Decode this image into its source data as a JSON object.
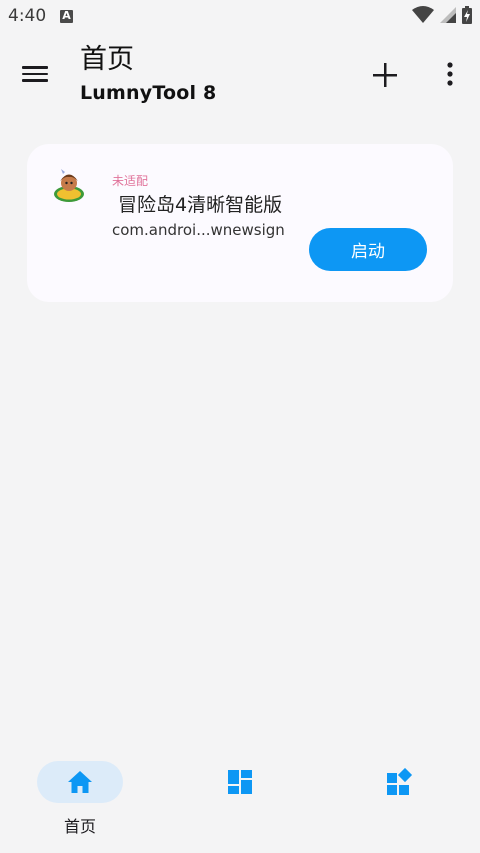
{
  "status_bar": {
    "time": "4:40"
  },
  "header": {
    "title": "首页",
    "subtitle": "LumnyTool 8"
  },
  "app_card": {
    "badge": "未适配",
    "name": "冒险岛4清晰智能版",
    "package": "com.androi...wnewsign",
    "launch_label": "启动"
  },
  "bottom_nav": {
    "items": [
      {
        "label": "首页",
        "icon": "home-icon",
        "active": true
      },
      {
        "label": "",
        "icon": "dashboard-icon",
        "active": false
      },
      {
        "label": "",
        "icon": "widgets-icon",
        "active": false
      }
    ]
  },
  "colors": {
    "accent": "#0d97f4",
    "badge": "#e0729a",
    "nav_active_bg": "#dcebf9"
  }
}
